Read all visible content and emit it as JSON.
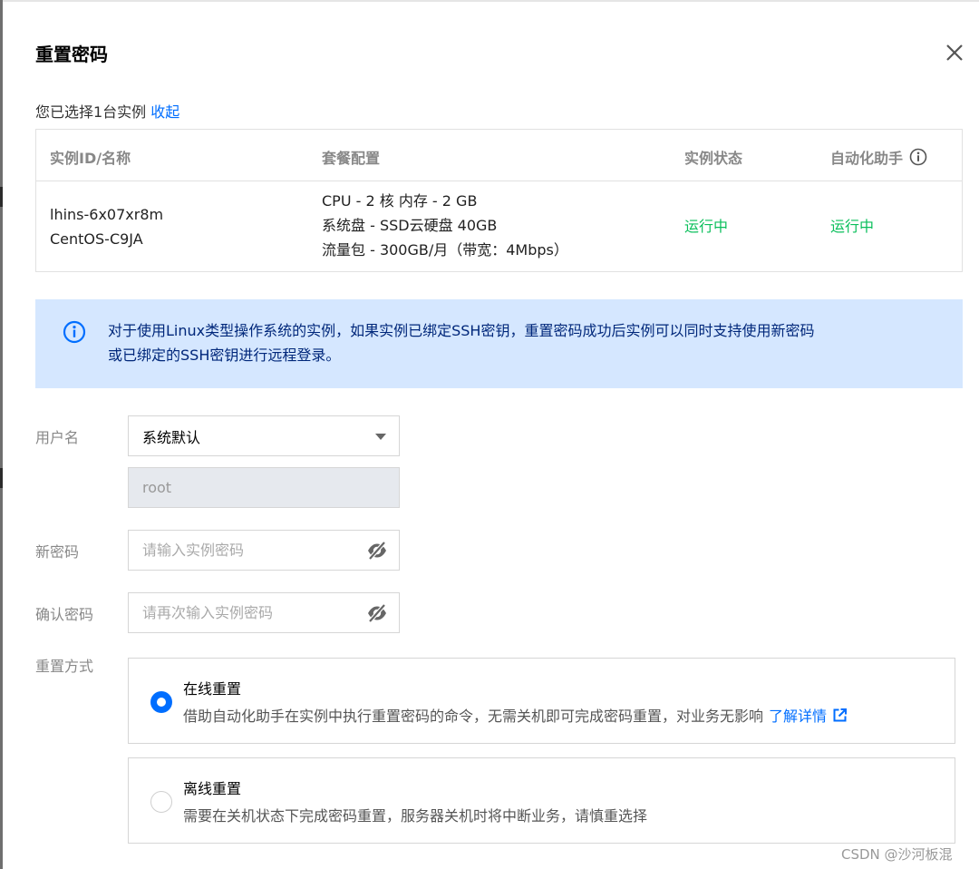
{
  "dialog": {
    "title": "重置密码"
  },
  "selection": {
    "text": "您已选择1台实例",
    "collapse_label": "收起"
  },
  "instance_table": {
    "columns": [
      "实例ID/名称",
      "套餐配置",
      "实例状态",
      "自动化助手"
    ],
    "row": {
      "id": "lhins-6x07xr8m",
      "name": "CentOS-C9JA",
      "config_lines": [
        "CPU - 2 核 内存 - 2 GB",
        "系统盘 - SSD云硬盘 40GB",
        "流量包 - 300GB/月（带宽：4Mbps）"
      ],
      "instance_status": "运行中",
      "assistant_status": "运行中"
    }
  },
  "notice": {
    "lines": [
      "对于使用Linux类型操作系统的实例，如果实例已绑定SSH密钥，重置密码成功后实例可以同时支持使用新密码",
      "或已绑定的SSH密钥进行远程登录。"
    ]
  },
  "form": {
    "username_label": "用户名",
    "username_select": "系统默认",
    "username_value": "root",
    "new_password_label": "新密码",
    "new_password_placeholder": "请输入实例密码",
    "confirm_password_label": "确认密码",
    "confirm_password_placeholder": "请再次输入实例密码",
    "reset_method_label": "重置方式"
  },
  "reset_options": [
    {
      "title": "在线重置",
      "description": "借助自动化助手在实例中执行重置密码的命令，无需关机即可完成密码重置，对业务无影响",
      "link": "了解详情",
      "selected": true
    },
    {
      "title": "离线重置",
      "description": "需要在关机状态下完成密码重置，服务器关机时将中断业务，请慎重选择",
      "selected": false
    }
  ],
  "watermark": "CSDN @沙河板混",
  "colors": {
    "accent": "#006eff",
    "status_green": "#0abf5b",
    "notice_bg": "#d5e7ff",
    "notice_text": "#00277a"
  }
}
